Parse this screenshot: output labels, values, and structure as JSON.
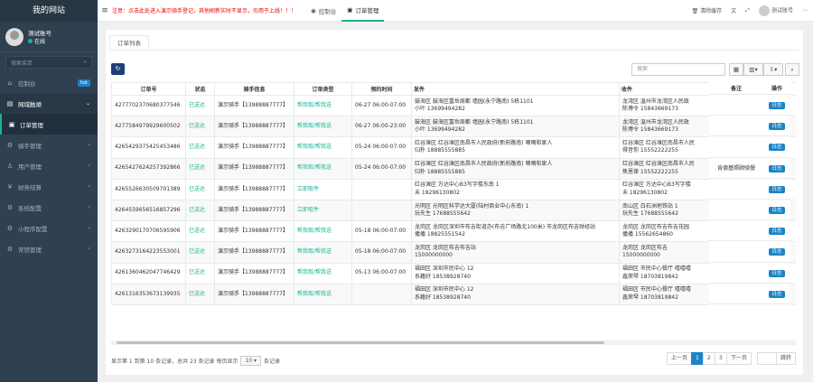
{
  "sidebar": {
    "brand": "我的网站",
    "user_name": "测试账号",
    "user_status": "在线",
    "search_placeholder": "搜索菜单",
    "items": [
      {
        "label": "控制台",
        "badge": "hot"
      },
      {
        "label": "网域触顺"
      },
      {
        "label": "订单管理"
      },
      {
        "label": "骑手管理"
      },
      {
        "label": "用户管理"
      },
      {
        "label": "财务结算"
      },
      {
        "label": "系统配置"
      },
      {
        "label": "小程序配置"
      },
      {
        "label": "常馆管理"
      }
    ]
  },
  "topbar": {
    "notice": "注意：点击此处进入演示骑手登记，其他刷新实时不显示，勿用于上线！！！",
    "tabs": [
      "控制台",
      "订单管理"
    ],
    "clear_cache": "清除缓存",
    "account": "测试账号"
  },
  "page": {
    "tab": "订单列表",
    "search_placeholder": "搜索",
    "columns": [
      "订单号",
      "状态",
      "骑手信息",
      "订单类型",
      "预约时间",
      "发件",
      "收件",
      "备注",
      "操作"
    ],
    "rows": [
      {
        "id": "427770237068037754​6",
        "status": "已送达",
        "rider": "演示骑手【13988887777】",
        "type": "帮我取/帮我送",
        "time": "06-27 06:00-07:00",
        "from1": "鼓海区 鼓海区富岳周都 墙园(永宁路南) 5栋1101",
        "from2": "小叶 13699494282",
        "to1": "龙湾区 温州市龙湾区人民政",
        "to2": "陈博令 15843669173",
        "note": "",
        "op": "日志"
      },
      {
        "id": "4277584979929600502",
        "status": "已送达",
        "rider": "演示骑手【13988887777】",
        "type": "帮我取/帮我送",
        "time": "06-27 06:00-23:00",
        "from1": "鼓海区 鼓海区富岳周都 墙园(永宁路南) 5栋1101",
        "from2": "小叶 13699494282",
        "to1": "龙湾区 温州市龙湾区人民政",
        "to2": "陈博令 15843669173",
        "note": "",
        "op": "日志"
      },
      {
        "id": "4265429375425453486",
        "status": "已送达",
        "rider": "演示骑手【13988887777】",
        "type": "帮我取/帮我送",
        "time": "05-24 06:00-07:00",
        "from1": "红谷滩区 红谷滩区南昌市人民政府(新府路南) 嘀嘀和家人",
        "from2": "归朴 18885555885",
        "to1": "红谷滩区 红谷滩区南昌市人民",
        "to2": "得音你 15552222255",
        "note": "",
        "op": "日志"
      },
      {
        "id": "4265427624257392866",
        "status": "已送达",
        "rider": "演示骑手【13988887777】",
        "type": "帮我取/帮我送",
        "time": "05-24 06:00-07:00",
        "from1": "红谷滩区 红谷滩区南昌市人民政府(新府路南) 嘀嘀和家人",
        "from2": "归朴 18885555885",
        "to1": "红谷滩区 红谷滩区南昌市人民",
        "to2": "焦恩律 15552222255",
        "note": "肯德基照顾骑慢",
        "op": "日志"
      },
      {
        "id": "4265526630509701389",
        "status": "已送达",
        "rider": "演示骑手【13988887777】",
        "type": "立即取件",
        "time": "",
        "from1": "红谷滩区 万达中心B3写字楼东南 1",
        "from2": "未 18296130802",
        "to1": "红谷滩区 万达中心B3写字楼",
        "to2": "未 18296130802",
        "note": "",
        "op": "日志"
      },
      {
        "id": "4264559656516857296",
        "status": "已送达",
        "rider": "演示骑手【13988887777】",
        "type": "立即取件",
        "time": "",
        "from1": "光明区 光明区科学达大厦(陆村商业中心东南) 1",
        "from2": "玩先生 17688555642",
        "to1": "南山区 白石洲地铁站 1",
        "to2": "玩先生 17688555642",
        "note": "",
        "op": "日志"
      },
      {
        "id": "4263290170706595906",
        "status": "已送达",
        "rider": "演示骑手【13988887777】",
        "type": "帮我取/帮我送",
        "time": "05-18 06:00-07:00",
        "from1": "龙岗区 龙岗区深圳市布吉街道办(布吉广场路北100米) 市龙岗区布吉财经站",
        "from2": "播播 18825551542",
        "to1": "龙岗区 龙岗区布吉布吉花园",
        "to2": "播播 15562654860",
        "note": "",
        "op": "日志"
      },
      {
        "id": "4263273164223553001",
        "status": "已送达",
        "rider": "演示骑手【13988887777】",
        "type": "帮我取/帮我送",
        "time": "05-18 06:00-07:00",
        "from1": "龙岗区 龙岗区布吉布吉站",
        "from2": "15000000000",
        "to1": "龙岗区 龙岗区布吉",
        "to2": "15000000000",
        "note": "",
        "op": "日志"
      },
      {
        "id": "4261360462047746429",
        "status": "已送达",
        "rider": "演示骑手【13988887777】",
        "type": "帮我取/帮我送",
        "time": "05-13 06:00-07:00",
        "from1": "福田区 深圳市民中心 12",
        "from2": "系籍好 18538928740",
        "to1": "福田区 市民中心餐厅 嘻嘻嘻",
        "to2": "鑫荣琴 18703819842",
        "note": "",
        "op": "日志"
      },
      {
        "id": "4261316353673139935",
        "status": "已送达",
        "rider": "演示骑手【13988887777】",
        "type": "帮我取/帮我送",
        "time": "",
        "from1": "福田区 深圳市民中心 12",
        "from2": "系籍好 18538928740",
        "to1": "福田区 市民中心餐厅 嘻嘻嘻",
        "to2": "鑫荣琴 18703819842",
        "note": "",
        "op": "日志"
      }
    ],
    "pagination": {
      "info_a": "显示第 1 到第 10 条记录，总共 23 条记录 每页显示",
      "per_page": "10",
      "info_b": "条记录",
      "prev": "上一页",
      "pages": [
        "1",
        "2",
        "3"
      ],
      "next": "下一页",
      "jump": "跳转"
    }
  },
  "watermark": "https://www.huzhan.com/ishop44131"
}
